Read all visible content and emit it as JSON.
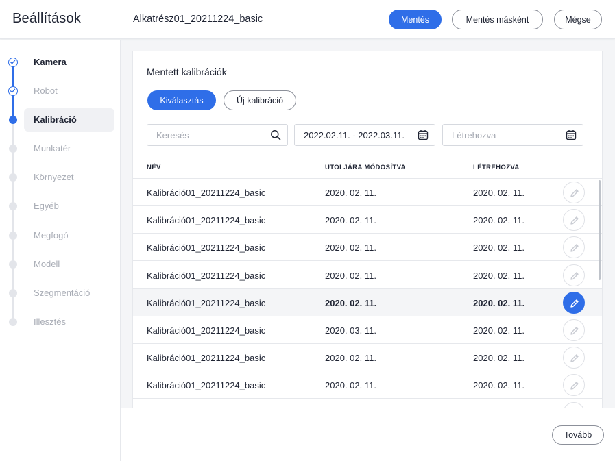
{
  "header": {
    "app_title": "Beállítások",
    "file_name": "Alkatrész01_20211224_basic",
    "save_label": "Mentés",
    "save_as_label": "Mentés másként",
    "cancel_label": "Mégse"
  },
  "sidebar": {
    "steps": [
      {
        "label": "Kamera",
        "state": "done"
      },
      {
        "label": "Robot",
        "state": "done"
      },
      {
        "label": "Kalibráció",
        "state": "active"
      },
      {
        "label": "Munkatér",
        "state": "pending"
      },
      {
        "label": "Környezet",
        "state": "pending"
      },
      {
        "label": "Egyéb",
        "state": "pending"
      },
      {
        "label": "Megfogó",
        "state": "pending"
      },
      {
        "label": "Modell",
        "state": "pending"
      },
      {
        "label": "Szegmentáció",
        "state": "pending"
      },
      {
        "label": "Illesztés",
        "state": "pending"
      }
    ]
  },
  "main": {
    "title": "Mentett kalibrációk",
    "tabs": {
      "select_label": "Kiválasztás",
      "new_label": "Új kalibráció"
    },
    "filters": {
      "search_placeholder": "Keresés",
      "date_range_value": "2022.02.11. - 2022.03.11.",
      "created_placeholder": "Létrehozva"
    },
    "table": {
      "headers": {
        "name": "NÉV",
        "modified": "UTOLJÁRA MÓDOSÍTVA",
        "created": "LÉTREHOZVA"
      },
      "rows": [
        {
          "name": "Kalibráció01_20211224_basic",
          "modified": "2020. 02. 11.",
          "created": "2020. 02. 11."
        },
        {
          "name": "Kalibráció01_20211224_basic",
          "modified": "2020. 02. 11.",
          "created": "2020. 02. 11."
        },
        {
          "name": "Kalibráció01_20211224_basic",
          "modified": "2020. 02. 11.",
          "created": "2020. 02. 11."
        },
        {
          "name": "Kalibráció01_20211224_basic",
          "modified": "2020. 02. 11.",
          "created": "2020. 02. 11."
        },
        {
          "name": "Kalibráció01_20211224_basic",
          "modified": "2020. 02. 11.",
          "created": "2020. 02. 11.",
          "selected": true
        },
        {
          "name": "Kalibráció01_20211224_basic",
          "modified": "2020. 03. 11.",
          "created": "2020. 02. 11."
        },
        {
          "name": "Kalibráció01_20211224_basic",
          "modified": "2020. 02. 11.",
          "created": "2020. 02. 11."
        },
        {
          "name": "Kalibráció01_20211224_basic",
          "modified": "2020. 02. 11.",
          "created": "2020. 02. 11."
        },
        {
          "name": "",
          "modified": "",
          "created": ""
        }
      ]
    }
  },
  "footer": {
    "next_label": "Tovább"
  },
  "colors": {
    "accent": "#2f6ee8",
    "text": "#1f2433",
    "muted": "#a9adb6",
    "border": "#e6e8ec"
  },
  "icons": {
    "search": "search-icon",
    "calendar": "calendar-icon",
    "edit": "pencil-icon",
    "done_step": "check-circle-icon"
  }
}
